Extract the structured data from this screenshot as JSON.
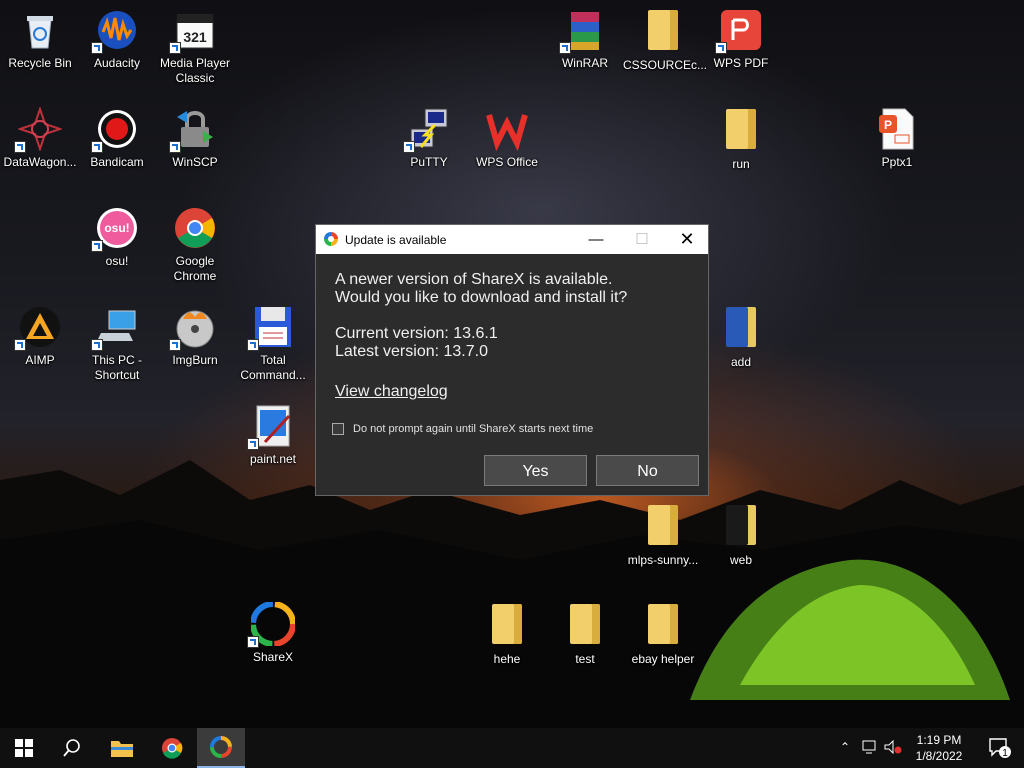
{
  "desktop": {
    "icons": {
      "recycle_bin": "Recycle Bin",
      "audacity": "Audacity",
      "mpc": "Media Player Classic",
      "winrar": "WinRAR",
      "cssource": "CSSOURCEc...",
      "wpspdf": "WPS PDF",
      "datawagon": "DataWagon...",
      "bandicam": "Bandicam",
      "winscp": "WinSCP",
      "putty": "PuTTY",
      "wpsoffice": "WPS Office",
      "run": "run",
      "pptx": "Pptx1",
      "osu": "osu!",
      "osu_glyph": "osu!",
      "chrome": "Google Chrome",
      "aimp": "AIMP",
      "thispc": "This PC - Shortcut",
      "imgburn": "ImgBurn",
      "totalcmd": "Total Command...",
      "add": "add",
      "paintnet": "paint.net",
      "mlps": "mlps-sunny...",
      "web": "web",
      "sharex": "ShareX",
      "hehe": "hehe",
      "test": "test",
      "ebay": "ebay helper",
      "mpc_badge": "321"
    }
  },
  "dialog": {
    "title": "Update is available",
    "message_line1": "A newer version of ShareX is available.",
    "message_line2": "Would you like to download and install it?",
    "current_version": "Current version: 13.6.1",
    "latest_version": "Latest version: 13.7.0",
    "changelog_link": "View changelog",
    "checkbox_label": "Do not prompt again until ShareX starts next time",
    "yes_label": "Yes",
    "no_label": "No"
  },
  "taskbar": {
    "time": "1:19 PM",
    "date": "1/8/2022",
    "notification_count": "1"
  },
  "colors": {
    "dialog_bg": "#2c2c2c",
    "button_bg": "#4a4a4a",
    "taskbar_bg": "#101010"
  }
}
